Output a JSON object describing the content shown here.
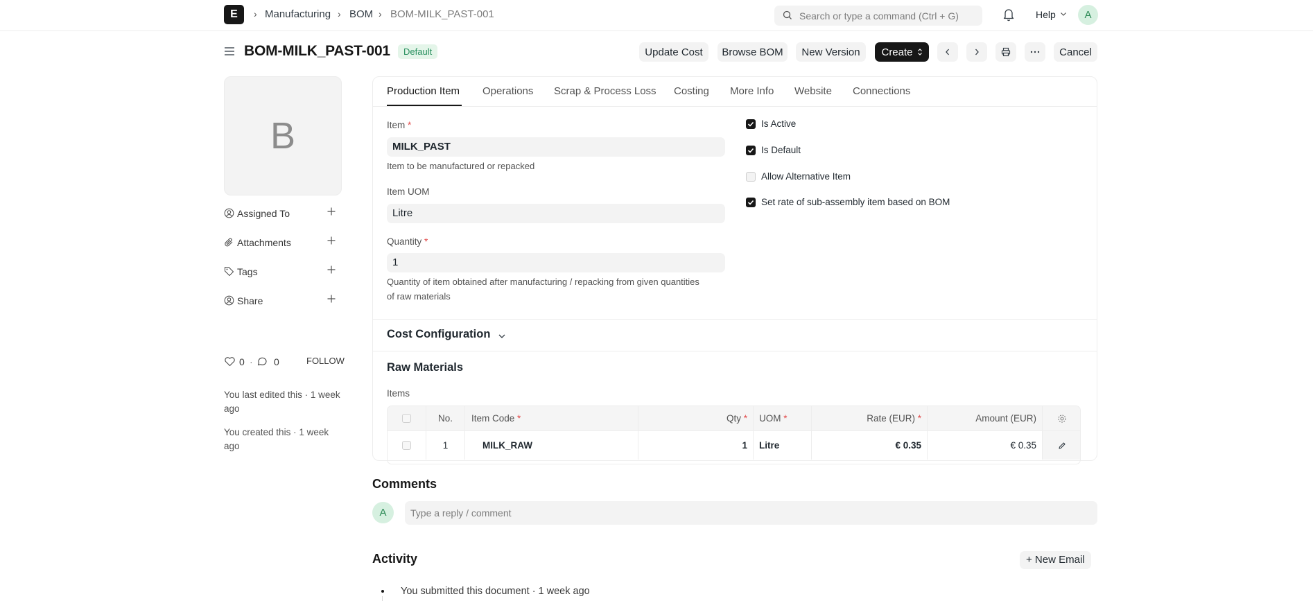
{
  "navbar": {
    "logo_letter": "E",
    "breadcrumbs": [
      "Manufacturing",
      "BOM",
      "BOM-MILK_PAST-001"
    ],
    "search_placeholder": "Search or type a command (Ctrl + G)",
    "help_label": "Help",
    "avatar_letter": "A"
  },
  "page": {
    "title": "BOM-MILK_PAST-001",
    "status": "Default",
    "actions": {
      "update_cost": "Update Cost",
      "browse_bom": "Browse BOM",
      "new_version": "New Version",
      "create": "Create",
      "cancel": "Cancel"
    }
  },
  "sidebar": {
    "image_letter": "B",
    "items": [
      {
        "label": "Assigned To",
        "icon": "assign-icon"
      },
      {
        "label": "Attachments",
        "icon": "paperclip-icon"
      },
      {
        "label": "Tags",
        "icon": "tag-icon"
      },
      {
        "label": "Share",
        "icon": "share-icon"
      }
    ],
    "likes": "0",
    "comments_count": "0",
    "follow_label": "FOLLOW",
    "last_edited": "You last edited this · 1 week ago",
    "created": "You created this · 1 week ago"
  },
  "tabs": [
    "Production Item",
    "Operations",
    "Scrap & Process Loss",
    "Costing",
    "More Info",
    "Website",
    "Connections"
  ],
  "form": {
    "item": {
      "label": "Item",
      "value": "MILK_PAST",
      "help": "Item to be manufactured or repacked"
    },
    "item_uom": {
      "label": "Item UOM",
      "value": "Litre"
    },
    "quantity": {
      "label": "Quantity",
      "value": "1",
      "help_line1": "Quantity of item obtained after manufacturing / repacking from given quantities",
      "help_line2": "of raw materials"
    },
    "checks": [
      {
        "label": "Is Active",
        "checked": true
      },
      {
        "label": "Is Default",
        "checked": true
      },
      {
        "label": "Allow Alternative Item",
        "checked": false
      },
      {
        "label": "Set rate of sub-assembly item based on BOM",
        "checked": true
      }
    ],
    "cost_config_title": "Cost Configuration",
    "raw_materials_title": "Raw Materials",
    "items_label": "Items"
  },
  "grid": {
    "headers": {
      "no": "No.",
      "item_code": "Item Code",
      "qty": "Qty",
      "uom": "UOM",
      "rate": "Rate (EUR)",
      "amount": "Amount (EUR)"
    },
    "rows": [
      {
        "no": "1",
        "item_code": "MILK_RAW",
        "qty": "1",
        "uom": "Litre",
        "rate": "€ 0.35",
        "amount": "€ 0.35"
      }
    ]
  },
  "comments": {
    "title": "Comments",
    "avatar_letter": "A",
    "placeholder": "Type a reply / comment"
  },
  "activity": {
    "title": "Activity",
    "new_email": "+ New Email",
    "entries": [
      "You submitted this document · 1 week ago"
    ]
  }
}
